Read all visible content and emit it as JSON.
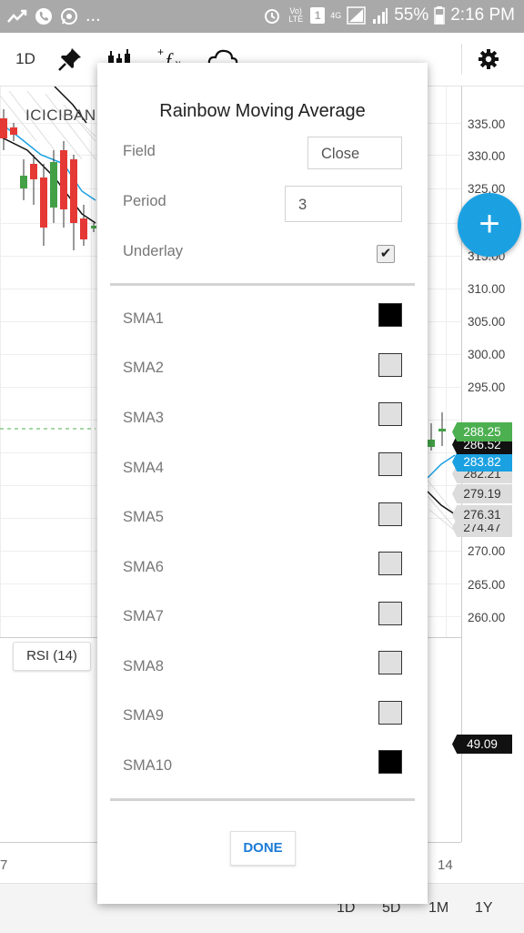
{
  "status_bar": {
    "network_label": "Vo) LTE",
    "notif_count": "1",
    "signal_label": "4G",
    "battery": "55%",
    "time": "2:16 PM",
    "dots": "..."
  },
  "toolbar": {
    "interval": "1D",
    "icons": [
      "pin-icon",
      "candles-icon",
      "fx-icon",
      "cloud-icon",
      "gear-icon"
    ]
  },
  "chart": {
    "symbol": "ICICIBANK",
    "price_ticks": [
      "335.00",
      "330.00",
      "325.00",
      "315.00",
      "310.00",
      "305.00",
      "300.00",
      "295.00",
      "270.00",
      "265.00",
      "260.00"
    ],
    "price_tags": [
      {
        "value": "288.25",
        "color": "#4caf50"
      },
      {
        "value": "286.52",
        "color": "#111111"
      },
      {
        "value": "283.82",
        "color": "#1ba1e2"
      },
      {
        "value": "282.21",
        "color": "#dcdcdc"
      },
      {
        "value": "279.19",
        "color": "#dcdcdc"
      },
      {
        "value": "276.31",
        "color": "#dcdcdc"
      },
      {
        "value": "274.47",
        "color": "#dcdcdc"
      }
    ],
    "rsi_label": "RSI (14)",
    "rsi_value": "49.09",
    "x_labels": [
      "7",
      "14"
    ]
  },
  "periods": [
    "1D",
    "5D",
    "1M",
    "1Y"
  ],
  "fab_label": "+",
  "dialog": {
    "title": "Rainbow Moving Average",
    "field_label": "Field",
    "field_value": "Close",
    "period_label": "Period",
    "period_value": "3",
    "underlay_label": "Underlay",
    "underlay_checked": "✔",
    "sma": [
      {
        "label": "SMA1",
        "color": "#000000"
      },
      {
        "label": "SMA2",
        "color": "#e0e0e0"
      },
      {
        "label": "SMA3",
        "color": "#e0e0e0"
      },
      {
        "label": "SMA4",
        "color": "#e0e0e0"
      },
      {
        "label": "SMA5",
        "color": "#e0e0e0"
      },
      {
        "label": "SMA6",
        "color": "#e0e0e0"
      },
      {
        "label": "SMA7",
        "color": "#e0e0e0"
      },
      {
        "label": "SMA8",
        "color": "#e0e0e0"
      },
      {
        "label": "SMA9",
        "color": "#e0e0e0"
      },
      {
        "label": "SMA10",
        "color": "#000000"
      }
    ],
    "done_label": "DONE"
  }
}
